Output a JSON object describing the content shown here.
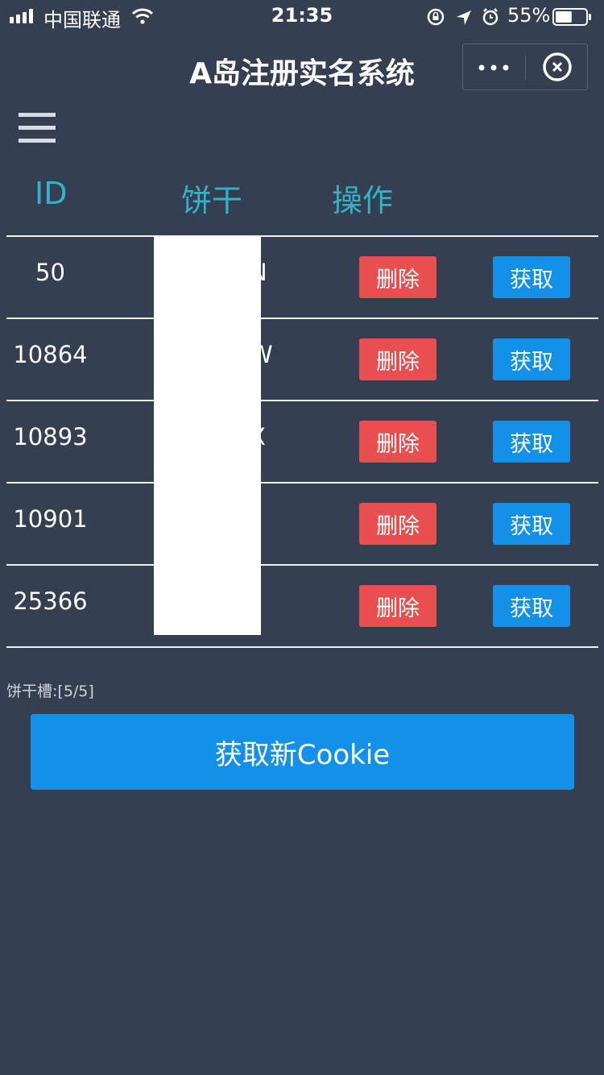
{
  "status_bar": {
    "carrier": "中国联通",
    "time": "21:35",
    "battery": "55%",
    "battery_level": 0.55
  },
  "nav": {
    "title": "A岛注册实名系统",
    "more_icon": "more-icon",
    "close_icon": "close-icon"
  },
  "menu_icon": "hamburger-menu-icon",
  "table": {
    "headers": [
      "ID",
      "饼干",
      "操作"
    ],
    "rows": [
      {
        "id": "50",
        "cookie": "N",
        "delete": "删除",
        "get": "获取"
      },
      {
        "id": "10864",
        "cookie": "W",
        "delete": "删除",
        "get": "获取"
      },
      {
        "id": "10893",
        "cookie": "X",
        "delete": "删除",
        "get": "获取"
      },
      {
        "id": "10901",
        "cookie": "",
        "delete": "删除",
        "get": "获取"
      },
      {
        "id": "25366",
        "cookie": "",
        "delete": "删除",
        "get": "获取"
      }
    ]
  },
  "slots_label": "饼干槽:[5/5]",
  "main_button": "获取新Cookie",
  "colors": {
    "background": "#353f52",
    "header_text": "#2fb4c8",
    "delete": "#e94f4f",
    "primary": "#1390e8"
  }
}
